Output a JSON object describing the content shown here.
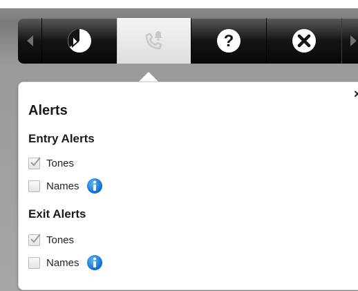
{
  "toolbar": {
    "buttons": [
      {
        "icon": "pie-chart-icon"
      },
      {
        "icon": "phone-alert-icon",
        "active": true
      },
      {
        "icon": "help-icon"
      },
      {
        "icon": "close-circle-icon"
      }
    ]
  },
  "panel": {
    "close_symbol": "×",
    "title": "Alerts",
    "entry": {
      "heading": "Entry Alerts",
      "tones_label": "Tones",
      "tones_checked": true,
      "names_label": "Names",
      "names_checked": false
    },
    "exit": {
      "heading": "Exit Alerts",
      "tones_label": "Tones",
      "tones_checked": true,
      "names_label": "Names",
      "names_checked": false
    }
  },
  "colors": {
    "info_blue": "#0b6bd1",
    "toolbar_dark": "#141414",
    "active_tab": "#e8e8e8"
  }
}
